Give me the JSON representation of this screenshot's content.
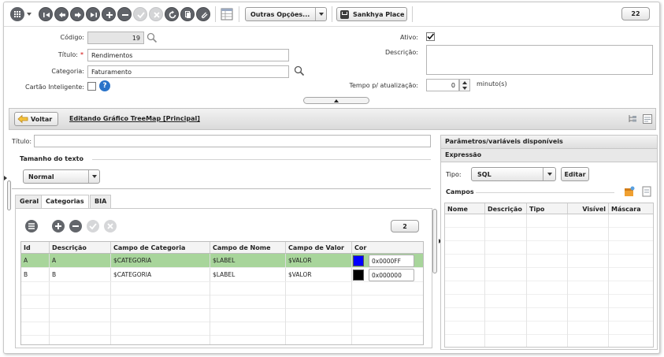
{
  "toolbar": {
    "grid_menu_icon": "grid-menu-icon",
    "outras_opcoes_label": "Outras Opções...",
    "sankhya_place_label": "Sankhya Place",
    "counter": "22"
  },
  "form": {
    "codigo_label": "Código:",
    "codigo_value": "19",
    "titulo_label": "Título:",
    "titulo_value": "Rendimentos",
    "categoria_label": "Categoria:",
    "categoria_value": "Faturamento",
    "cartao_label": "Cartão Inteligente:",
    "ativo_label": "Ativo:",
    "ativo_checked": true,
    "descricao_label": "Descrição:",
    "descricao_value": "",
    "tempo_label": "Tempo p/ atualização:",
    "tempo_value": "0",
    "tempo_unit": "minuto(s)",
    "required_mark": "*"
  },
  "navbar": {
    "voltar_label": "Voltar",
    "editing_title": "Editando Gráfico TreeMap [Principal]"
  },
  "left": {
    "titulo_label": "Título:",
    "titulo_value": "",
    "tamanho_label": "Tamanho do texto",
    "tamanho_value": "Normal",
    "tabs": [
      "Geral",
      "Categorias",
      "BIA"
    ],
    "active_tab": "Categorias",
    "record_count": "2",
    "grid": {
      "columns": [
        "Id",
        "Descrição",
        "Campo de Categoria",
        "Campo de Nome",
        "Campo de Valor",
        "Cor"
      ],
      "rows": [
        {
          "id": "A",
          "descricao": "A",
          "categoria": "$CATEGORIA",
          "nome": "$LABEL",
          "valor": "$VALOR",
          "cor": "0x0000FF",
          "swatch": "#0000ff"
        },
        {
          "id": "B",
          "descricao": "B",
          "categoria": "$CATEGORIA",
          "nome": "$LABEL",
          "valor": "$VALOR",
          "cor": "0x000000",
          "swatch": "#000000"
        }
      ]
    }
  },
  "right": {
    "params_title": "Parâmetros/variáveis disponíveis",
    "expressao_label": "Expressão",
    "tipo_label": "Tipo:",
    "tipo_value": "SQL",
    "editar_label": "Editar",
    "campos_label": "Campos",
    "columns": [
      "Nome",
      "Descrição",
      "Tipo",
      "Visível",
      "Máscara"
    ]
  },
  "colors": {
    "selected_row": "#a8d59b",
    "accent_blue": "#0000ff"
  }
}
